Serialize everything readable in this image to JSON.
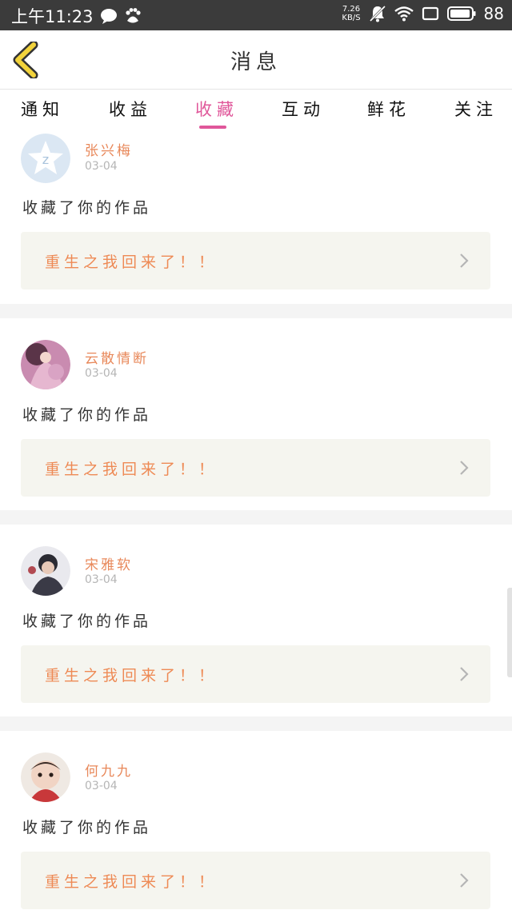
{
  "status_bar": {
    "time": "上午11:23",
    "net_speed_value": "7.26",
    "net_speed_unit": "KB/S",
    "battery": "88",
    "icons": [
      "chat-bubble-icon",
      "baidu-paw-icon",
      "muted-bell-icon",
      "wifi-icon",
      "screen-icon",
      "battery-icon"
    ]
  },
  "header": {
    "title": "消息",
    "back_icon": "back-chevron-icon"
  },
  "tabs": {
    "items": [
      {
        "label": "通知"
      },
      {
        "label": "收益"
      },
      {
        "label": "收藏"
      },
      {
        "label": "互动"
      },
      {
        "label": "鲜花"
      },
      {
        "label": "关注"
      }
    ],
    "active_index": 2,
    "active_color": "#e0579a"
  },
  "messages": [
    {
      "user": "张兴梅",
      "date": "03-04",
      "action": "收藏了你的作品",
      "work_title": "重生之我回来了！！",
      "avatar": "default-star-avatar"
    },
    {
      "user": "云散情断",
      "date": "03-04",
      "action": "收藏了你的作品",
      "work_title": "重生之我回来了！！",
      "avatar": "pink-dress-avatar"
    },
    {
      "user": "宋雅软",
      "date": "03-04",
      "action": "收藏了你的作品",
      "work_title": "重生之我回来了！！",
      "avatar": "person-portrait-avatar"
    },
    {
      "user": "何九九",
      "date": "03-04",
      "action": "收藏了你的作品",
      "work_title": "重生之我回来了！！",
      "avatar": "baby-portrait-avatar"
    }
  ],
  "colors": {
    "accent": "#e0579a",
    "username": "#e8885a",
    "work_title": "#ee8a55",
    "back_icon": "#f2d33c"
  }
}
